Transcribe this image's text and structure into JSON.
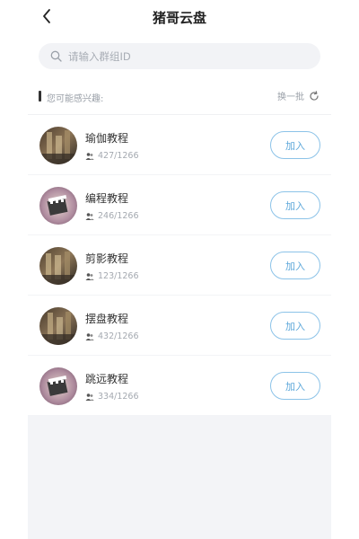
{
  "header": {
    "title": "猪哥云盘",
    "back_icon": "chevron-left-icon"
  },
  "search": {
    "placeholder": "请输入群组ID",
    "icon": "search-icon"
  },
  "suggestions": {
    "title": "您可能感兴趣:",
    "refresh_label": "换一批",
    "refresh_icon": "refresh-icon"
  },
  "groups": [
    {
      "name": "瑜伽教程",
      "members": "427/1266",
      "join_label": "加入"
    },
    {
      "name": "编程教程",
      "members": "246/1266",
      "join_label": "加入"
    },
    {
      "name": "剪影教程",
      "members": "123/1266",
      "join_label": "加入"
    },
    {
      "name": "摆盘教程",
      "members": "432/1266",
      "join_label": "加入"
    },
    {
      "name": "跳远教程",
      "members": "334/1266",
      "join_label": "加入"
    }
  ],
  "colors": {
    "accent": "#5ea8da",
    "button_border": "#8cc3e8",
    "muted_text": "#a4a9b0",
    "search_bg": "#f2f3f6"
  }
}
